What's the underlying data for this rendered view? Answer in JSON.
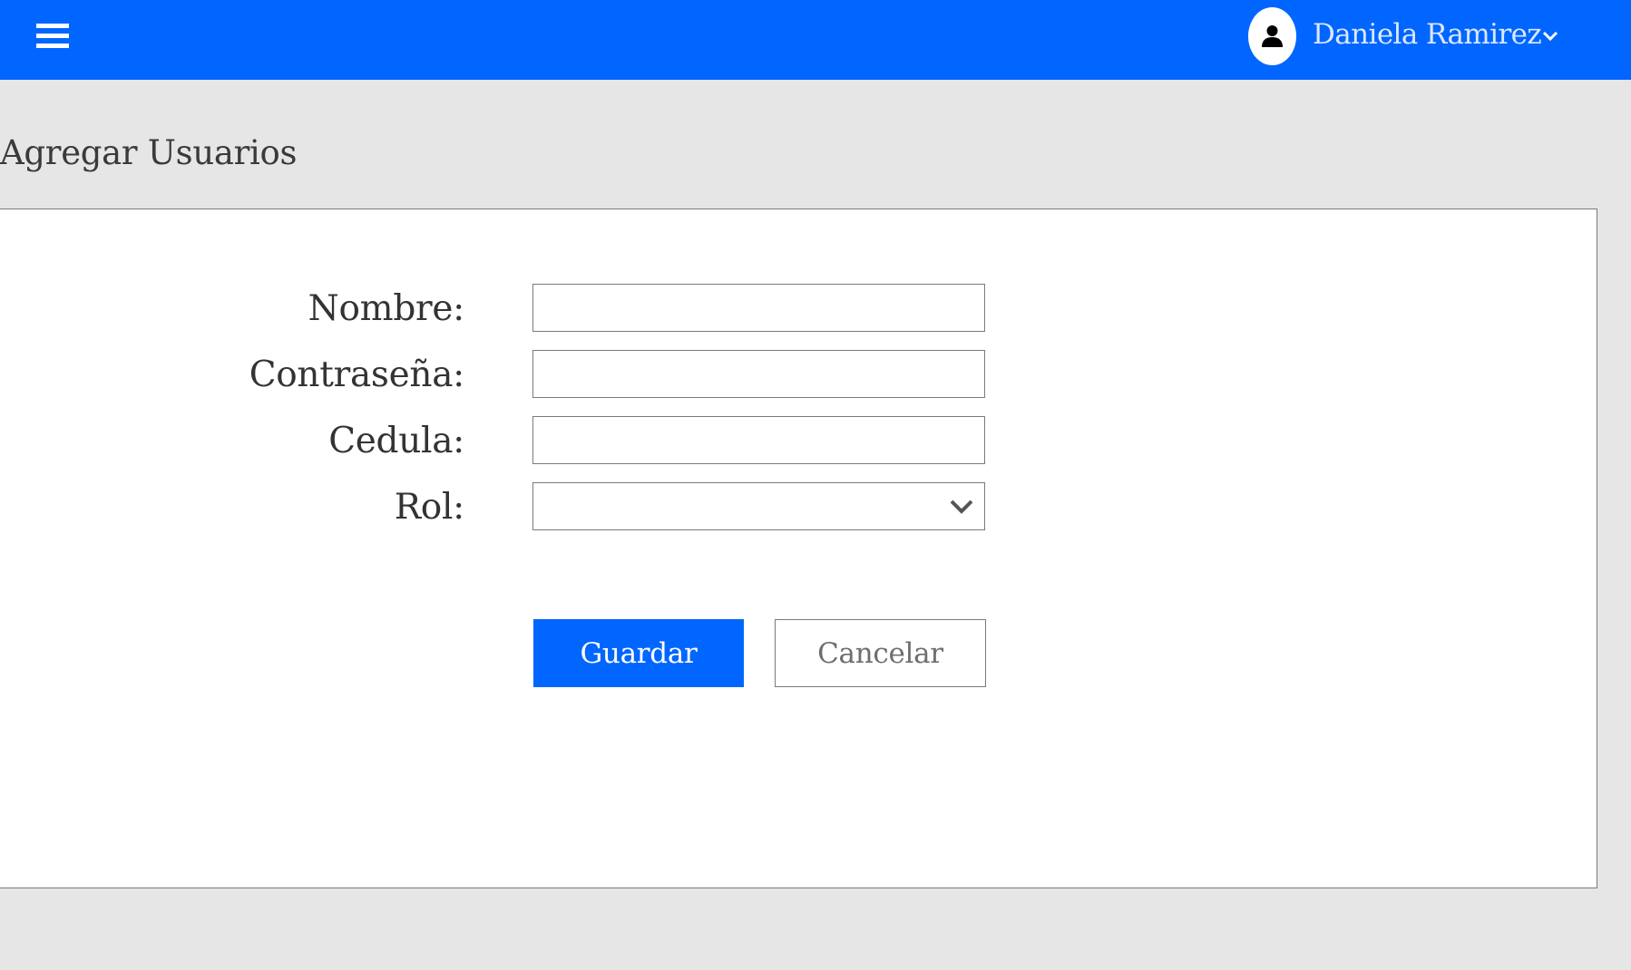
{
  "header": {
    "menu_icon": "hamburger-menu-icon",
    "user": {
      "avatar_icon": "user-icon",
      "name": "Daniela Ramirez",
      "dropdown_icon": "chevron-down-icon"
    }
  },
  "page": {
    "title": "Agregar Usuarios"
  },
  "form": {
    "fields": [
      {
        "label": "Nombre:",
        "value": "",
        "placeholder": ""
      },
      {
        "label": "Contraseña:",
        "value": "",
        "placeholder": ""
      },
      {
        "label": "Cedula:",
        "value": "",
        "placeholder": ""
      }
    ],
    "role": {
      "label": "Rol:",
      "selected": "",
      "dropdown_icon": "chevron-down-icon"
    },
    "buttons": {
      "save": "Guardar",
      "cancel": "Cancelar"
    }
  },
  "colors": {
    "brand": "#0066ff",
    "background": "#e6e6e6",
    "panel": "#ffffff",
    "border": "#7a7a7a",
    "text": "#333333"
  }
}
